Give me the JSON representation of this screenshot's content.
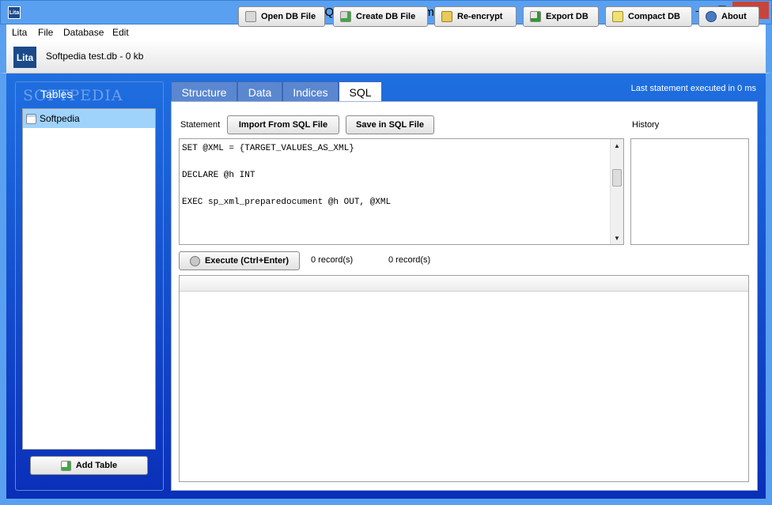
{
  "window": {
    "title": "Lita - SQLite Database Administration",
    "app_icon_text": "Lita",
    "minimize": "—",
    "maximize": "☐",
    "close": "✕"
  },
  "menu": [
    "Lita",
    "File",
    "Database",
    "Edit"
  ],
  "toolbar": {
    "logo": "Lita",
    "db_info": "Softpedia test.db - 0 kb",
    "buttons": [
      "Open DB File",
      "Create DB File",
      "Re-encrypt",
      "Export DB",
      "Compact DB",
      "About"
    ]
  },
  "left_panel": {
    "header": "Tables",
    "watermark": "SOFTPEDIA",
    "tables": [
      "Softpedia"
    ],
    "add_button": "Add Table"
  },
  "tabs": [
    "Structure",
    "Data",
    "Indices",
    "SQL"
  ],
  "active_tab": "SQL",
  "status": "Last statement executed in 0 ms",
  "sql": {
    "statement_label": "Statement",
    "import_button": "Import From SQL File",
    "save_button": "Save in SQL File",
    "history_label": "History",
    "code": "SET @XML = {TARGET_VALUES_AS_XML}\n\nDECLARE @h INT\n\nEXEC sp_xml_preparedocument @h OUT, @XML",
    "execute_button": "Execute (Ctrl+Enter)",
    "records_1": "0 record(s)",
    "records_2": "0 record(s)"
  }
}
